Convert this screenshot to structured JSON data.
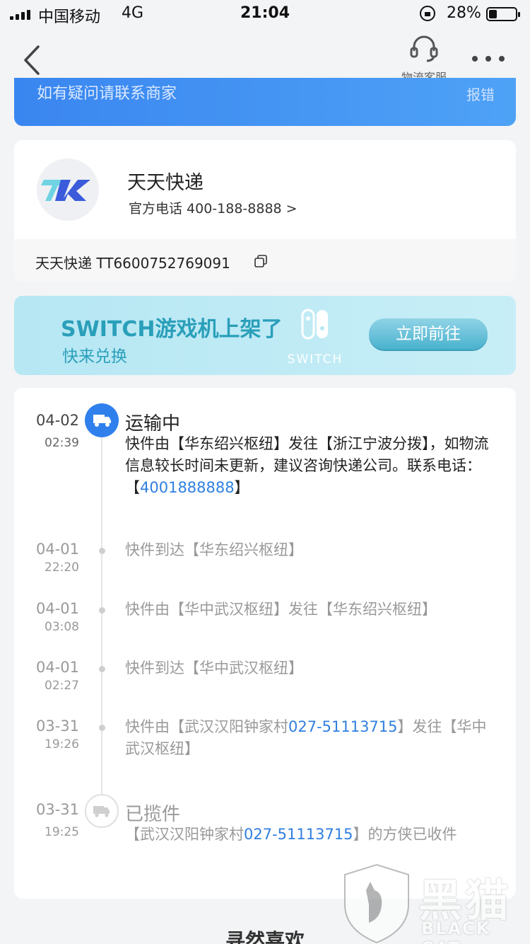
{
  "status_bar": {
    "carrier": "中国移动",
    "network": "4G",
    "time": "21:04",
    "battery": "28%"
  },
  "nav": {
    "service_label": "物流客服"
  },
  "notice": {
    "text": "如有疑问请联系商家",
    "report": "报错"
  },
  "courier": {
    "name": "天天快递",
    "phone": "官方电话 400-188-8888 >",
    "tracking": "天天快递 TT6600752769091"
  },
  "promo": {
    "title": "SWITCH游戏机上架了",
    "subtitle": "快来兑换",
    "logo_text": "SWITCH",
    "button": "立即前往"
  },
  "timeline": [
    {
      "date": "04-02",
      "time": "02:39",
      "status": "运输中",
      "desc_pre": "快件由【华东绍兴枢纽】发往【浙江宁波分拨】，如物流信息较长时间未更新，建议咨询快递公司。联系电话：【",
      "desc_link": "4001888888",
      "desc_post": "】"
    },
    {
      "date": "04-01",
      "time": "22:20",
      "desc_pre": "快件到达【华东绍兴枢纽】"
    },
    {
      "date": "04-01",
      "time": "03:08",
      "desc_pre": "快件由【华中武汉枢纽】发往【华东绍兴枢纽】"
    },
    {
      "date": "04-01",
      "time": "02:27",
      "desc_pre": "快件到达【华中武汉枢纽】"
    },
    {
      "date": "03-31",
      "time": "19:26",
      "desc_pre": "快件由【武汉汉阳钟家村",
      "desc_link": "027-51113715",
      "desc_post": "】发往【华中武汉枢纽】"
    },
    {
      "date": "03-31",
      "time": "19:25",
      "status": "已揽件",
      "desc_pre": "【武汉汉阳钟家村",
      "desc_link": "027-51113715",
      "desc_post": "】的方侠已收件"
    }
  ],
  "bottom": {
    "like_title": "寻然喜欢"
  },
  "watermark": {
    "cn": "黑猫",
    "en": "BLACK CAT"
  },
  "colors": {
    "accent_blue": "#2f80ed",
    "link_blue": "#2f7fe0",
    "promo_teal": "#2a9fba"
  }
}
